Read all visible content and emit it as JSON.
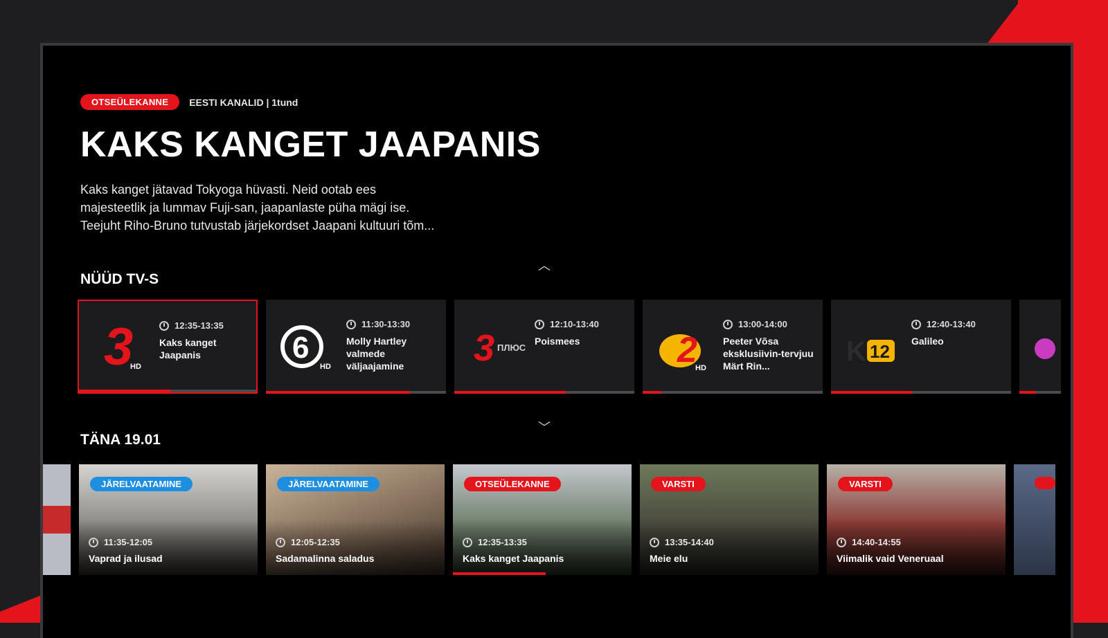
{
  "hero": {
    "live_badge": "OTSEÜLEKANNE",
    "channel_meta": "EESTI KANALID | 1tund",
    "title": "KAKS KANGET JAAPANIS",
    "description_lines": [
      "Kaks kanget jätavad Tokyoga hüvasti. Neid ootab ees",
      "majesteetlik ja lummav Fuji-san, jaapanlaste püha mägi ise.",
      "Teejuht Riho-Bruno tutvustab järjekordset Jaapani kultuuri tõm..."
    ]
  },
  "now_section": {
    "title": "NÜÜD TV-S",
    "cards": [
      {
        "logo": "tv3-hd-logo",
        "logo_text": "3",
        "logo_sub": "HD",
        "time": "12:35-13:35",
        "name": "Kaks kanget Jaapanis",
        "progress": 0.52,
        "selected": true
      },
      {
        "logo": "kanal6-hd-logo",
        "logo_text": "6",
        "logo_sub": "HD",
        "time": "11:30-13:30",
        "name": "Molly Hartley valmede väljaajamine",
        "progress": 0.8
      },
      {
        "logo": "tv3-plus-logo",
        "logo_text": "3",
        "logo_sub": "ПЛЮС",
        "time": "12:10-13:40",
        "name": "Poismees",
        "progress": 0.62
      },
      {
        "logo": "kanal2-hd-logo",
        "logo_text": "2",
        "logo_sub": "HD",
        "time": "13:00-14:00",
        "name": "Peeter Võsa eksklusiivin-tervjuu Märt Rin...",
        "progress": 0.1
      },
      {
        "logo": "kanal12-logo",
        "logo_text": "12",
        "logo_sub": "",
        "time": "12:40-13:40",
        "name": "Galileo",
        "progress": 0.45
      }
    ]
  },
  "today_section": {
    "title": "TÄNA 19.01",
    "tiles": [
      {
        "badge": "JÄRELVAATAMINE",
        "badge_color": "blue",
        "time": "11:35-12:05",
        "name": "Vaprad ja ilusad"
      },
      {
        "badge": "JÄRELVAATAMINE",
        "badge_color": "blue",
        "time": "12:05-12:35",
        "name": "Sadamalinna saladus"
      },
      {
        "badge": "OTSEÜLEKANNE",
        "badge_color": "red",
        "time": "12:35-13:35",
        "name": "Kaks kanget Jaapanis",
        "progress": 0.52
      },
      {
        "badge": "VARSTI",
        "badge_color": "red",
        "time": "13:35-14:40",
        "name": "Meie elu"
      },
      {
        "badge": "VARSTI",
        "badge_color": "red",
        "time": "14:40-14:55",
        "name": "Viimalik vaid Veneruaal"
      }
    ]
  },
  "colors": {
    "accent": "#e3141b",
    "blue_badge": "#1e8fe0",
    "card_bg": "#1c1c1e"
  }
}
